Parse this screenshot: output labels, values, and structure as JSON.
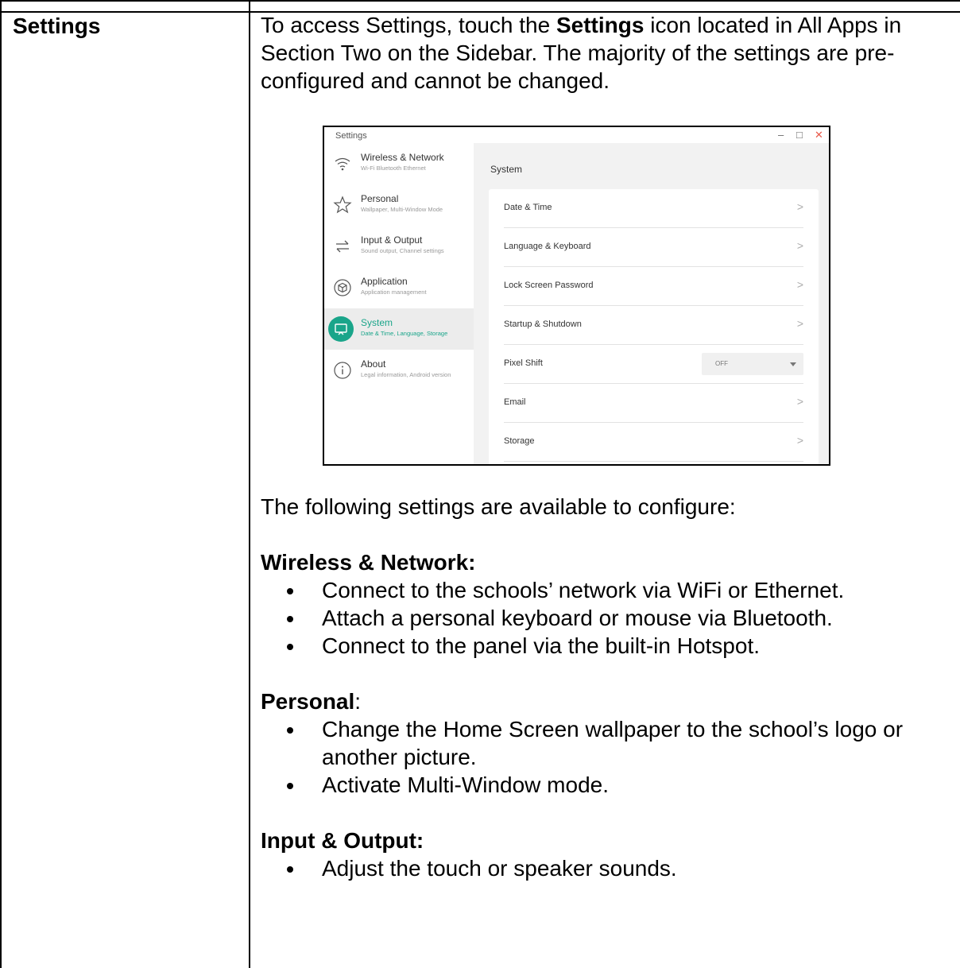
{
  "row_heading": "Settings",
  "intro": {
    "part1": "To access Settings, touch the ",
    "bold": "Settings",
    "part2": " icon located in All Apps in Section Two on the Sidebar. The majority of the settings are pre-configured and cannot be changed."
  },
  "screenshot": {
    "window_title": "Settings",
    "controls": [
      "–",
      "□",
      "✕"
    ],
    "sidebar": [
      {
        "label": "Wireless & Network",
        "sub": "Wi-Fi Bluetooth Ethernet",
        "icon": "wifi-icon"
      },
      {
        "label": "Personal",
        "sub": "Wallpaper, Multi-Window Mode",
        "icon": "star-icon"
      },
      {
        "label": "Input & Output",
        "sub": "Sound output, Channel settings",
        "icon": "swap-arrows-icon"
      },
      {
        "label": "Application",
        "sub": "Application management",
        "icon": "cube-icon"
      },
      {
        "label": "System",
        "sub": "Date & Time, Language, Storage",
        "icon": "display-icon"
      },
      {
        "label": "About",
        "sub": "Legal information, Android version",
        "icon": "info-icon"
      }
    ],
    "active_index": 4,
    "accent_color": "#1aa58a",
    "main_title": "System",
    "rows": [
      {
        "label": "Date & Time"
      },
      {
        "label": "Language & Keyboard"
      },
      {
        "label": "Lock Screen Password"
      },
      {
        "label": "Startup & Shutdown"
      },
      {
        "label": "Pixel Shift",
        "dropdown": "OFF"
      },
      {
        "label": "Email"
      },
      {
        "label": "Storage"
      }
    ],
    "chevron": ">"
  },
  "available_text": "The following settings are available to configure:",
  "sections": [
    {
      "head": "Wireless & Network:",
      "head_suffix": "",
      "items": [
        "Connect to the schools’ network via WiFi or Ethernet.",
        "Attach a personal keyboard or mouse via Bluetooth.",
        "Connect to the panel via the built-in Hotspot."
      ]
    },
    {
      "head": "Personal",
      "head_suffix": ":",
      "items": [
        "Change the Home Screen wallpaper to the school’s logo or another picture.",
        "Activate Multi-Window mode."
      ]
    },
    {
      "head": "Input & Output:",
      "head_suffix": "",
      "items": [
        "Adjust the touch or speaker sounds."
      ]
    }
  ]
}
